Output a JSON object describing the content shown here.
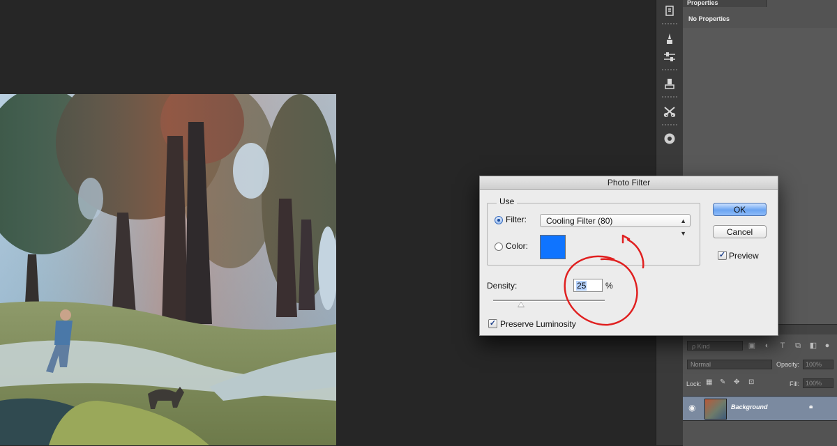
{
  "panels": {
    "properties": {
      "tab_label": "Properties",
      "empty_text": "No Properties"
    },
    "layers": {
      "kind_label": "ρ Kind",
      "blend_mode": "Normal",
      "opacity_label": "Opacity:",
      "opacity_value": "100%",
      "lock_label": "Lock:",
      "fill_label": "Fill:",
      "fill_value": "100%",
      "layer_name": "Background"
    }
  },
  "dialog": {
    "title": "Photo Filter",
    "use_label": "Use",
    "filter_label": "Filter:",
    "filter_value": "Cooling Filter (80)",
    "color_label": "Color:",
    "color_value": "#0f74ff",
    "density_label": "Density:",
    "density_value": "25",
    "density_unit": "%",
    "density_level": 0.25,
    "preserve_luminosity_label": "Preserve Luminosity",
    "preserve_luminosity_checked": true,
    "preview_label": "Preview",
    "preview_checked": true,
    "ok_label": "OK",
    "cancel_label": "Cancel"
  },
  "annotation_color": "#e02020",
  "tools": [
    "history-icon",
    "brush-presets-icon",
    "adjustments-icon",
    "clone-source-icon",
    "tool-presets-icon",
    "navigator-icon"
  ]
}
